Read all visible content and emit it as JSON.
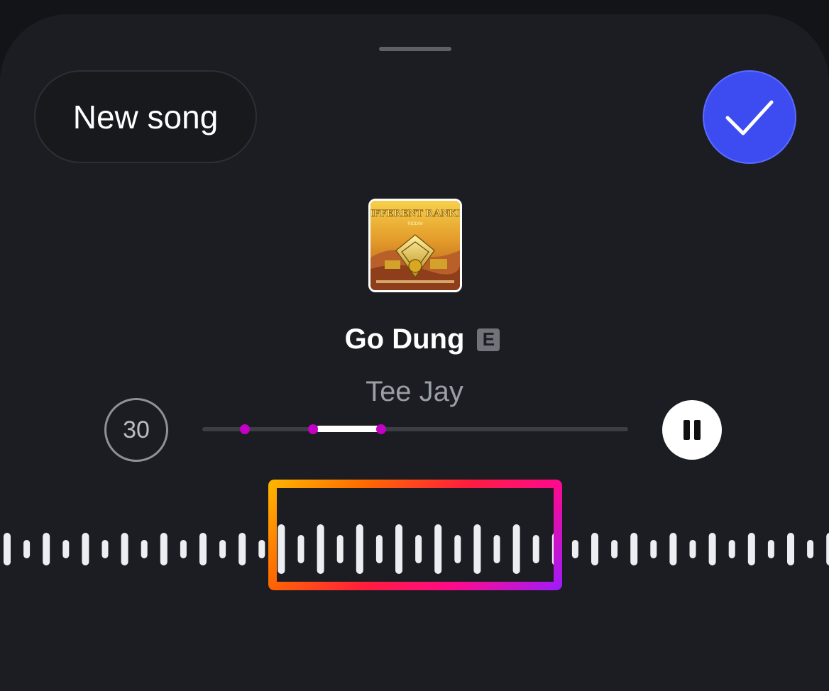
{
  "header": {
    "new_song_label": "New song",
    "done_icon": "checkmark-icon"
  },
  "track": {
    "title": "Go Dung",
    "explicit_badge": "E",
    "artist": "Tee Jay",
    "cover_art_text": "DIFFERENT RANKIN",
    "cover_art_sub": "RIDDIM"
  },
  "player": {
    "duration_label": "30",
    "selection_start_fraction": 0.27,
    "selection_end_fraction": 0.42,
    "pause_icon": "pause-icon"
  },
  "colors": {
    "sheet_bg": "#1b1d22",
    "accent_blue": "#3d4cf0",
    "marker_magenta": "#c400c4",
    "selector_gradient": [
      "#ffb800",
      "#ff6a00",
      "#ff1e3c",
      "#ff0a8a",
      "#9b1cff"
    ]
  }
}
